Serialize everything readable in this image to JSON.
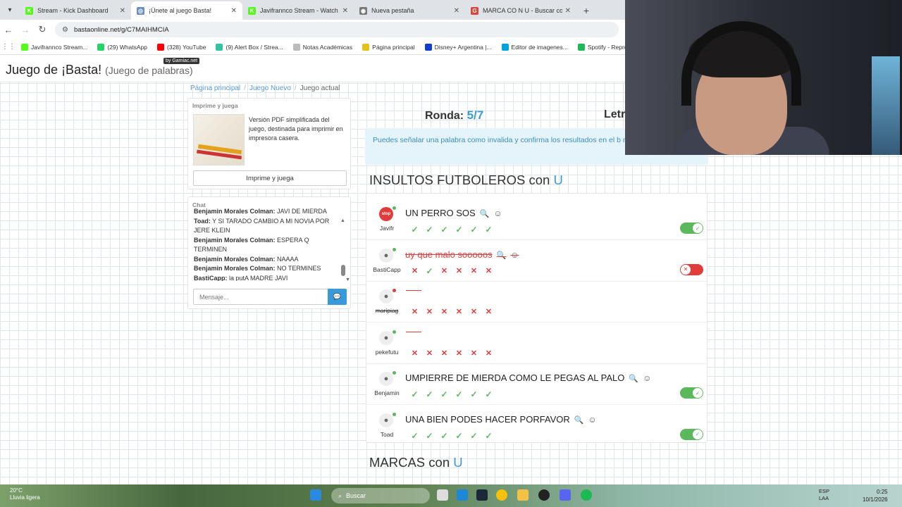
{
  "browser": {
    "tabs": [
      {
        "title": "Stream - Kick Dashboard",
        "icon": "kick-icon",
        "color": "#53fc18",
        "glyph": "K",
        "active": false
      },
      {
        "title": "¡Únete al juego Basta!",
        "icon": "globe-icon",
        "color": "#6c8ebf",
        "glyph": "◎",
        "active": true
      },
      {
        "title": "Javifrannco Stream - Watch Live",
        "icon": "kick-icon",
        "color": "#53fc18",
        "glyph": "K",
        "active": false
      },
      {
        "title": "Nueva pestaña",
        "icon": "chrome-icon",
        "color": "#777",
        "glyph": "◉",
        "active": false
      },
      {
        "title": "MARCA CO N U - Buscar con G",
        "icon": "google-icon",
        "color": "#db4437",
        "glyph": "G",
        "active": false
      }
    ],
    "url": "bastaonline.net/g/C7MAIHMCIA",
    "bookmarks": [
      {
        "label": "Javifrannco Stream...",
        "color": "#53fc18"
      },
      {
        "label": "(29) WhatsApp",
        "color": "#25d366"
      },
      {
        "label": "(328) YouTube",
        "color": "#ff0000"
      },
      {
        "label": "(9) Alert Box / Strea...",
        "color": "#31c3a2"
      },
      {
        "label": "Notas Académicas",
        "color": "#bbbbbb"
      },
      {
        "label": "Página principal",
        "color": "#e4c01b"
      },
      {
        "label": "Disney+ Argentina |...",
        "color": "#113ccf"
      },
      {
        "label": "Editor de imagenes...",
        "color": "#00a3e0"
      },
      {
        "label": "Spotify - Reproduct...",
        "color": "#1db954"
      }
    ]
  },
  "site": {
    "title": "Juego de ¡Basta!",
    "subtitle": "(Juego de palabras)",
    "badge": "by Gamiac.net",
    "breadcrumb": [
      "Página principal",
      "Juego Nuevo",
      "Juego actual"
    ]
  },
  "print": {
    "heading": "Imprime y juega",
    "description": "Versión PDF simplificada del juego, destinada para imprimir en impresora casera.",
    "button": "Imprime y juega"
  },
  "chat": {
    "heading": "Chat",
    "messages": [
      {
        "user": "Benjamin Morales Colman:",
        "text": "JAVI DE MIERDA"
      },
      {
        "user": "Toad:",
        "text": "Y SI TARADO CAMBIO A MI NOVIA POR JERE KLEIN"
      },
      {
        "user": "Benjamin Morales Colman:",
        "text": "ESPERA Q TERMINEN"
      },
      {
        "user": "Benjamin Morales Colman:",
        "text": "NAAAA"
      },
      {
        "user": "Benjamin Morales Colman:",
        "text": "NO TERMINES"
      },
      {
        "user": "BastiCapp:",
        "text": "la putA MADRE JAVI"
      }
    ],
    "placeholder": "Mensaje..."
  },
  "game": {
    "round_label": "Ronda:",
    "round_value": "5/7",
    "letter_label": "Letr",
    "notice": "Puedes señalar una palabra como invalida y confirma los resultados en el b más abajo.",
    "categories": [
      {
        "name": "INSULTOS FUTBOLEROS con",
        "letter": "U"
      },
      {
        "name": "MARCAS con",
        "letter": "U"
      }
    ],
    "answers": [
      {
        "player": "Javifr",
        "word": "UN PERRO SOS",
        "status": "valid",
        "online": true,
        "stop": true,
        "votes": [
          "ok",
          "ok",
          "ok",
          "ok",
          "ok",
          "ok"
        ],
        "toggle": "on"
      },
      {
        "player": "BastiCapp",
        "word": "uy que malo sooooos",
        "status": "invalid",
        "online": true,
        "stop": false,
        "votes": [
          "no",
          "ok",
          "no",
          "no",
          "no",
          "no"
        ],
        "toggle": "off"
      },
      {
        "player": "maripiag",
        "word": "",
        "status": "empty",
        "online": false,
        "stop": false,
        "votes": [
          "no",
          "no",
          "no",
          "no",
          "no",
          "no"
        ],
        "toggle": "none"
      },
      {
        "player": "pekefutu",
        "word": "",
        "status": "empty",
        "online": true,
        "stop": false,
        "votes": [
          "no",
          "no",
          "no",
          "no",
          "no",
          "no"
        ],
        "toggle": "none"
      },
      {
        "player": "Benjamin",
        "word": "UMPIERRE DE MIERDA COMO LE PEGAS AL PALO",
        "status": "valid",
        "online": true,
        "stop": false,
        "votes": [
          "ok",
          "ok",
          "ok",
          "ok",
          "ok",
          "ok"
        ],
        "toggle": "on"
      },
      {
        "player": "Toad",
        "word": "UNA BIEN PODES HACER PORFAVOR",
        "status": "valid",
        "online": true,
        "stop": false,
        "votes": [
          "ok",
          "ok",
          "ok",
          "ok",
          "ok",
          "ok"
        ],
        "toggle": "on"
      }
    ]
  },
  "taskbar": {
    "weather_temp": "20°C",
    "weather_desc": "Lluvia ligera",
    "search": "Buscar",
    "lang": [
      "ESP",
      "LAA"
    ],
    "time": "0:25",
    "date": "10/1/2026"
  }
}
